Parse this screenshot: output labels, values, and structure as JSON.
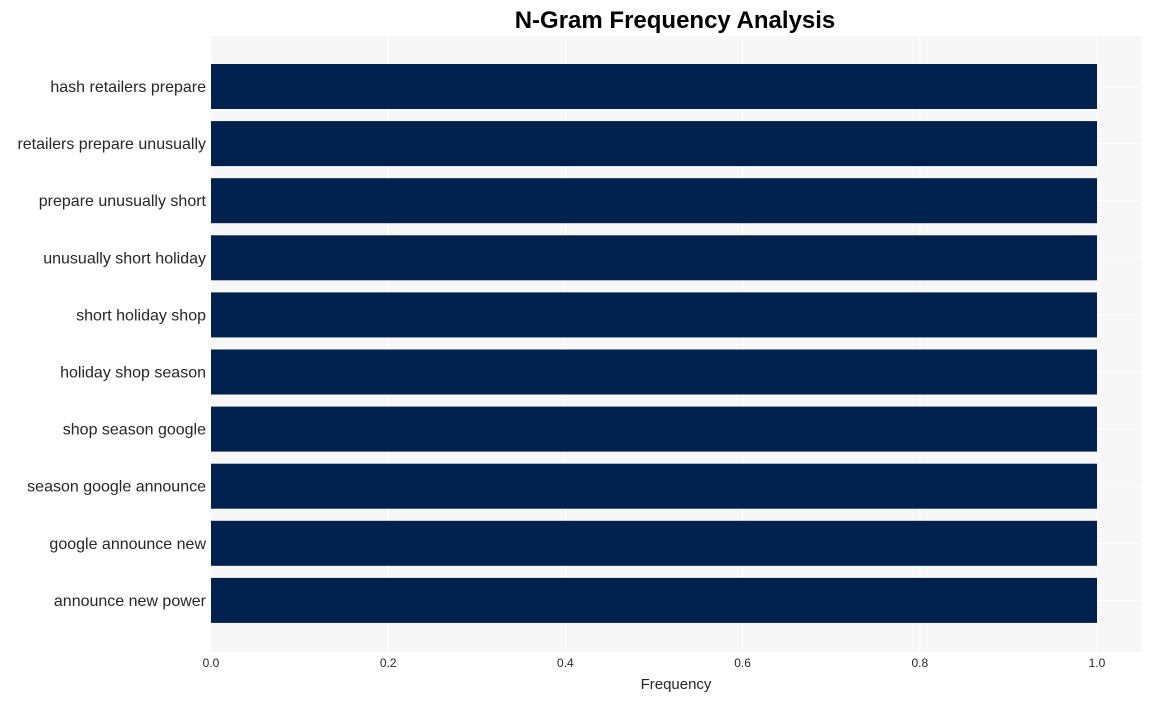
{
  "chart_data": {
    "type": "bar",
    "orientation": "horizontal",
    "title": "N-Gram Frequency Analysis",
    "xlabel": "Frequency",
    "ylabel": "",
    "categories": [
      "hash retailers prepare",
      "retailers prepare unusually",
      "prepare unusually short",
      "unusually short holiday",
      "short holiday shop",
      "holiday shop season",
      "shop season google",
      "season google announce",
      "google announce new",
      "announce new power"
    ],
    "values": [
      1,
      1,
      1,
      1,
      1,
      1,
      1,
      1,
      1,
      1
    ],
    "xlim": [
      0,
      1.05
    ],
    "xticks": [
      0.0,
      0.2,
      0.4,
      0.6,
      0.8,
      1.0
    ],
    "xtick_labels": [
      "0.0",
      "0.2",
      "0.4",
      "0.6",
      "0.8",
      "1.0"
    ],
    "grid": true,
    "legend": "none",
    "colors": {
      "bar": "#00214d",
      "plot_background": "#f7f7f7",
      "grid": "#ffffff"
    }
  }
}
